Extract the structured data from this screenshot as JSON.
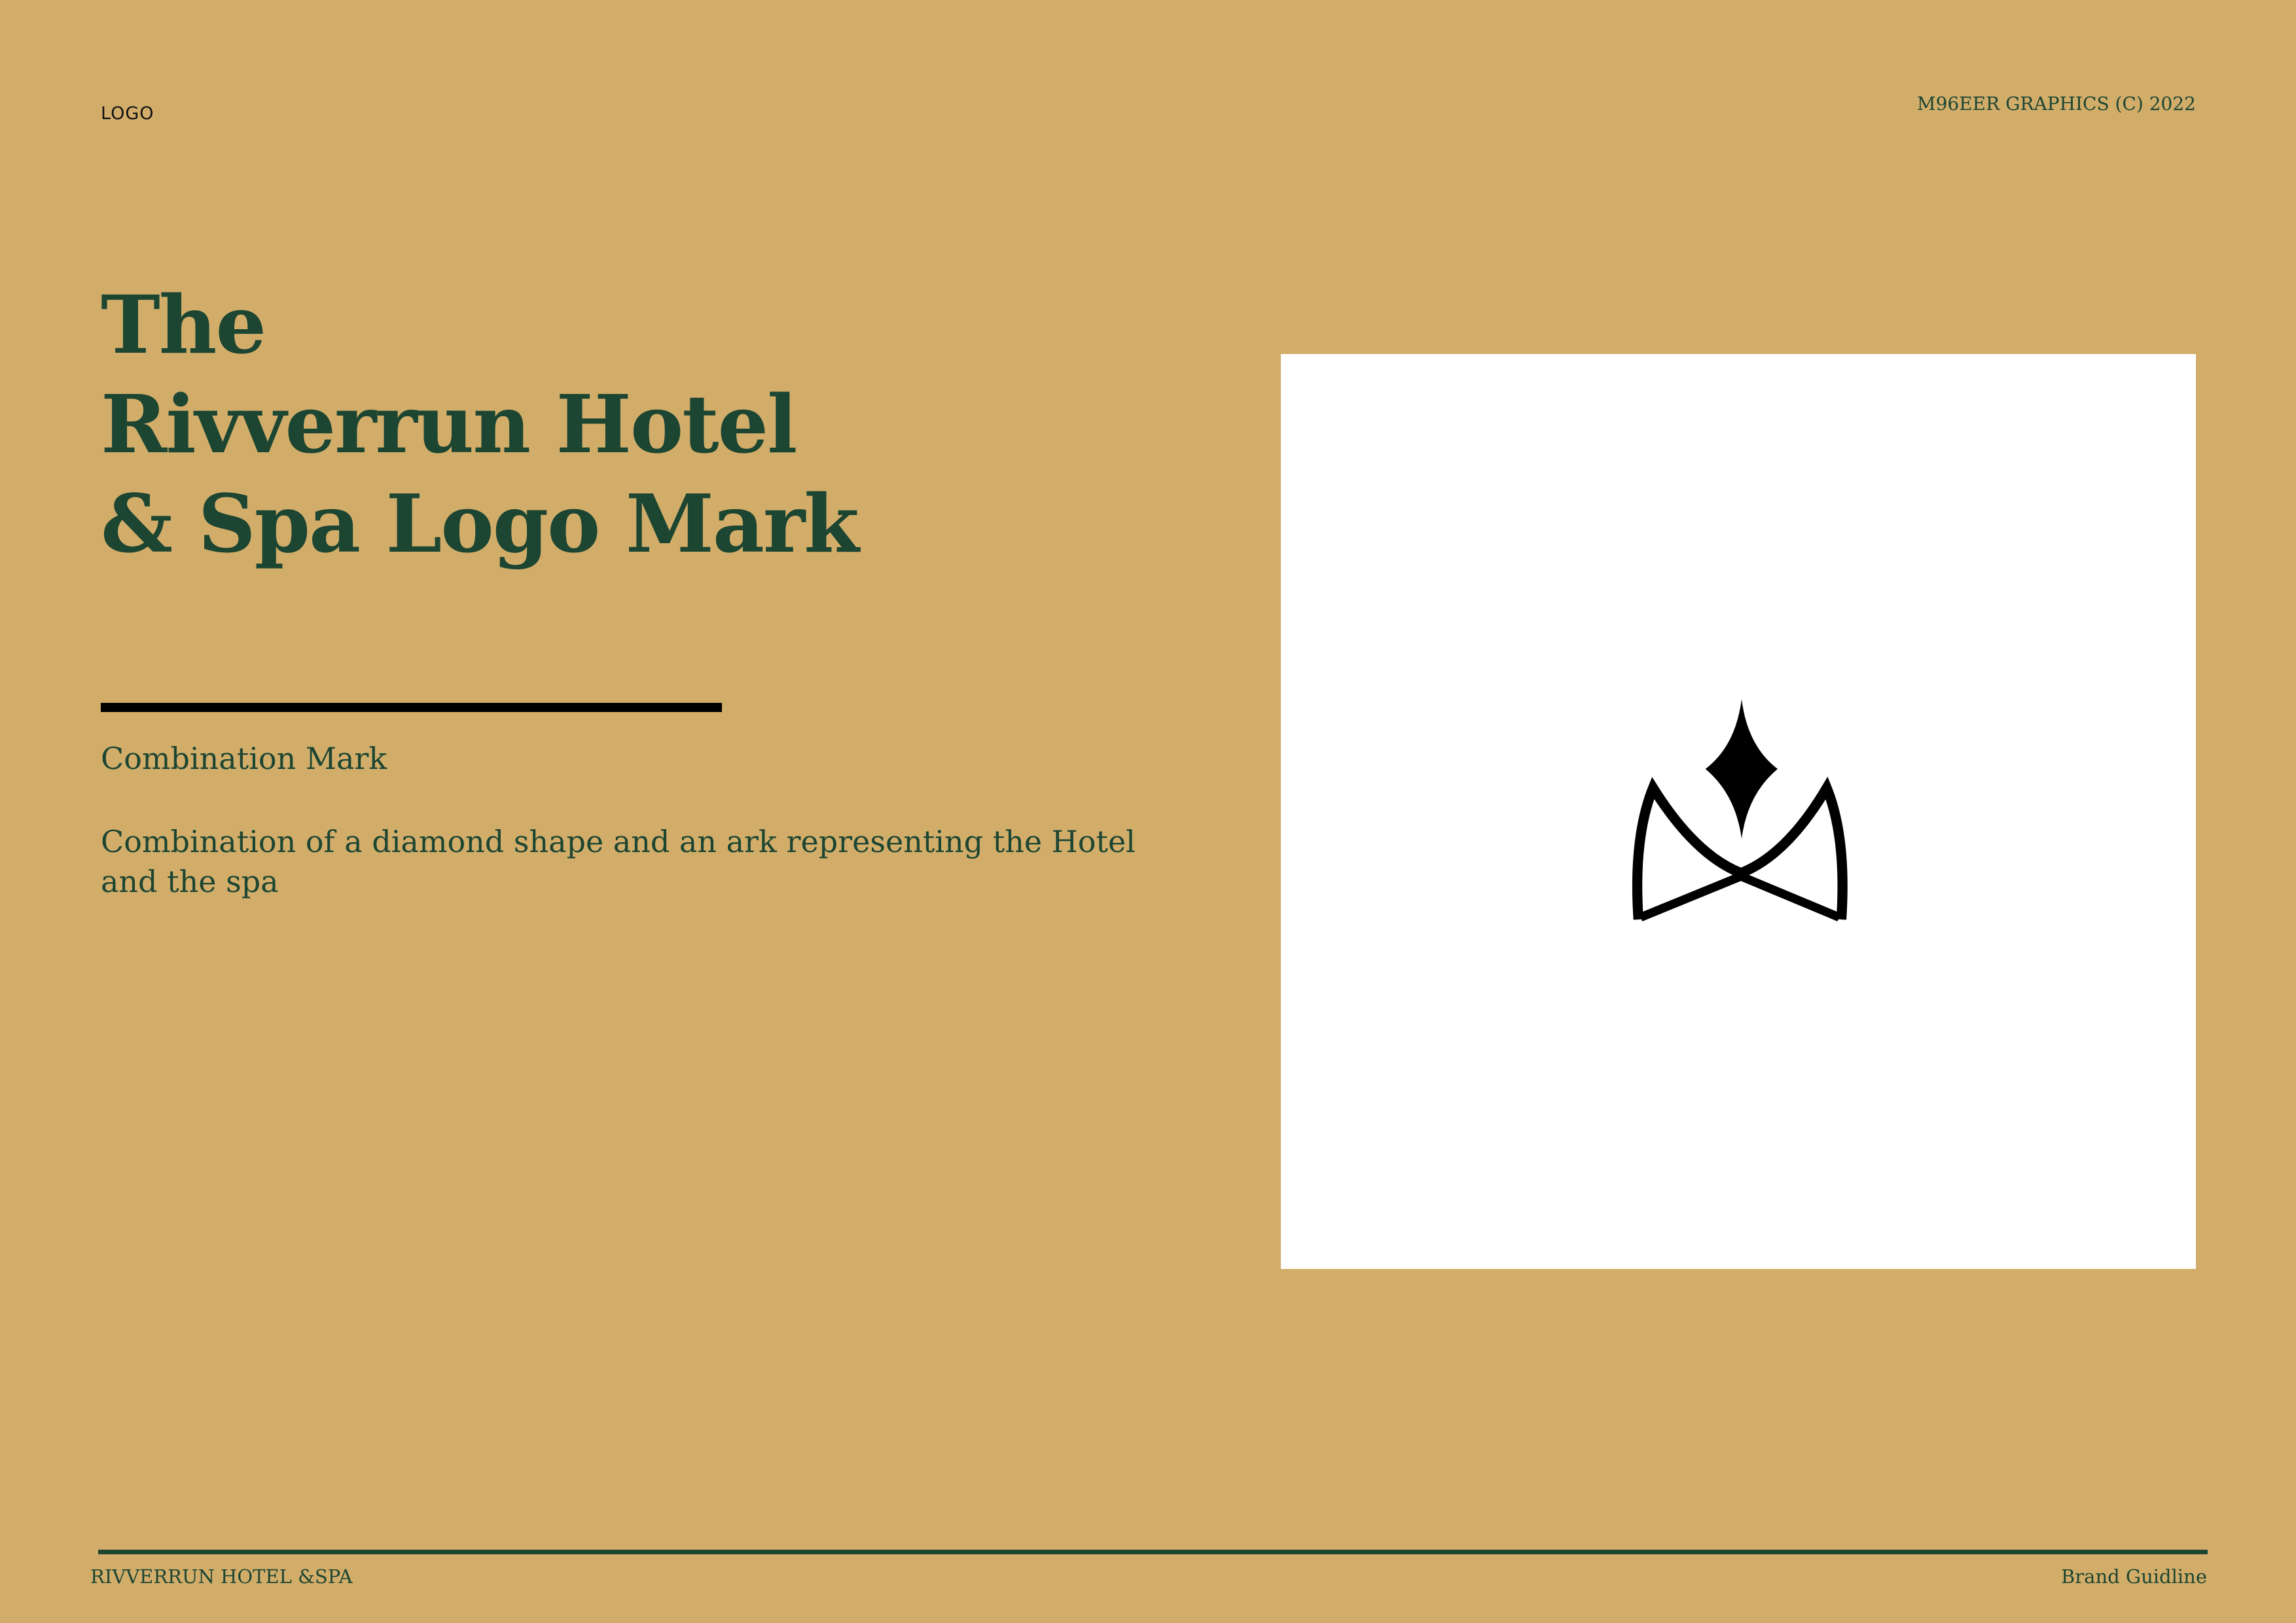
{
  "header": {
    "logo_label": "LOGO",
    "copyright": "M96EER GRAPHICS (C) 2022"
  },
  "main": {
    "title_lines": [
      "The",
      "Rivverrun Hotel",
      "& Spa Logo Mark"
    ],
    "subtitle": "Combination Mark",
    "description": "Combination of a diamond shape and an ark representing the Hotel and the spa"
  },
  "logo_mark": {
    "icon": "diamond-ark-logo-icon",
    "color": "#000000"
  },
  "footer": {
    "left": "RIVVERRUN HOTEL &SPA",
    "right": "Brand Guidline"
  },
  "colors": {
    "background": "#D2AD6A",
    "text": "#1C4532",
    "panel": "#FFFFFF"
  }
}
